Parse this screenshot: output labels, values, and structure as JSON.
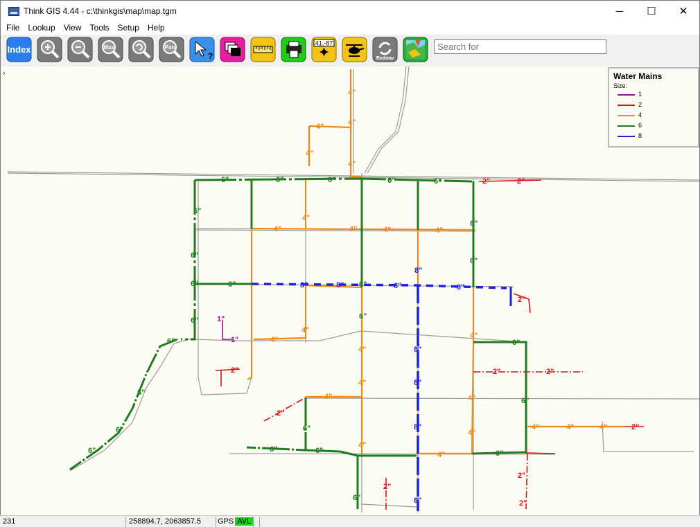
{
  "window": {
    "title": "Think GIS 4.44 - c:\\thinkgis\\map\\map.tgm",
    "minimize": "─",
    "maximize": "☐",
    "close": "✕"
  },
  "menu": [
    "File",
    "Lookup",
    "View",
    "Tools",
    "Setup",
    "Help"
  ],
  "toolbar": {
    "index_label": "Index",
    "max_label": "Max",
    "pan_label": "Pan",
    "coord_label": "41;-87",
    "redraw_label": "Redraw",
    "search_placeholder": "Search for"
  },
  "legend": {
    "title": "Water Mains",
    "subtitle": "Size:",
    "items": [
      {
        "label": "1",
        "color": "#8a1a8a"
      },
      {
        "label": "2",
        "color": "#e01010"
      },
      {
        "label": "4",
        "color": "#f08a14"
      },
      {
        "label": "6",
        "color": "#1e7d1e"
      },
      {
        "label": "8",
        "color": "#2020e0"
      }
    ]
  },
  "status": {
    "value": "231",
    "coords": "258894.7, 2063857.5",
    "gps": "GPS",
    "avl": "AVL"
  },
  "map_labels": {
    "one": "1\"",
    "two": "2\"",
    "four": "4\"",
    "six": "6\"",
    "eight": "8\""
  }
}
